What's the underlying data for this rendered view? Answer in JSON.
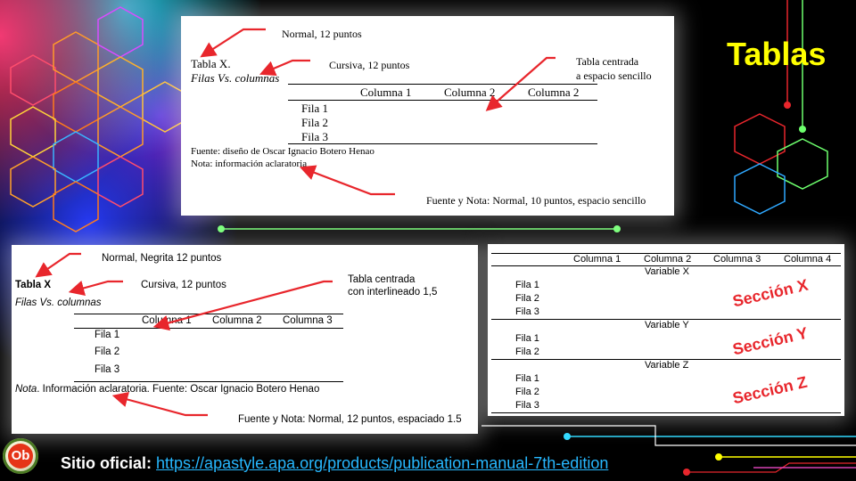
{
  "slide_title": "Tablas",
  "panel_a": {
    "notes": {
      "normal": "Normal, 12 puntos",
      "cursiva": "Cursiva, 12 puntos",
      "centrada_1": "Tabla centrada",
      "centrada_2": "a espacio sencillo",
      "fuente_nota": "Fuente y Nota: Normal,  10 puntos, espacio sencillo"
    },
    "table_label": "Tabla X.",
    "table_subtitle": "Filas Vs. columnas",
    "columns": [
      "Columna 1",
      "Columna 2",
      "Columna 2"
    ],
    "rows": [
      "Fila 1",
      "Fila 2",
      "Fila 3"
    ],
    "source": "Fuente: diseño de Oscar Ignacio Botero Henao",
    "note": "Nota: información aclaratoria"
  },
  "panel_b": {
    "notes": {
      "normal": "Normal, Negrita 12 puntos",
      "cursiva": "Cursiva, 12 puntos",
      "centrada_1": "Tabla centrada",
      "centrada_2": "con interlineado 1,5",
      "fuente_nota": "Fuente y Nota: Normal, 12 puntos, espaciado 1.5"
    },
    "table_label": "Tabla X",
    "table_subtitle": "Filas Vs. columnas",
    "columns": [
      "Columna 1",
      "Columna 2",
      "Columna 3"
    ],
    "rows": [
      "Fila 1",
      "Fila 2",
      "Fila 3"
    ],
    "note_label": "Nota",
    "note_text": ". Información aclaratoria. Fuente: Oscar Ignacio Botero Henao"
  },
  "panel_c": {
    "columns": [
      "Columna 1",
      "Columna 2",
      "Columna 3",
      "Columna 4"
    ],
    "sections": [
      {
        "variable": "Variable X",
        "rows": [
          "Fila 1",
          "Fila 2",
          "Fila 3"
        ],
        "label": "Sección X"
      },
      {
        "variable": "Variable Y",
        "rows": [
          "Fila 1",
          "Fila 2"
        ],
        "label": "Sección Y"
      },
      {
        "variable": "Variable Z",
        "rows": [
          "Fila 1",
          "Fila 2",
          "Fila 3"
        ],
        "label": "Sección Z"
      }
    ]
  },
  "footer": {
    "label": "Sitio oficial:",
    "url": "https://apastyle.apa.org/products/publication-manual-7th-edition"
  },
  "logo_text": "Ob",
  "colors": {
    "title": "#ffff00",
    "arrow": "#e8262c",
    "link": "#27b8ff",
    "connector_green": "#6dff6d",
    "connector_cyan": "#2fd9ff"
  }
}
